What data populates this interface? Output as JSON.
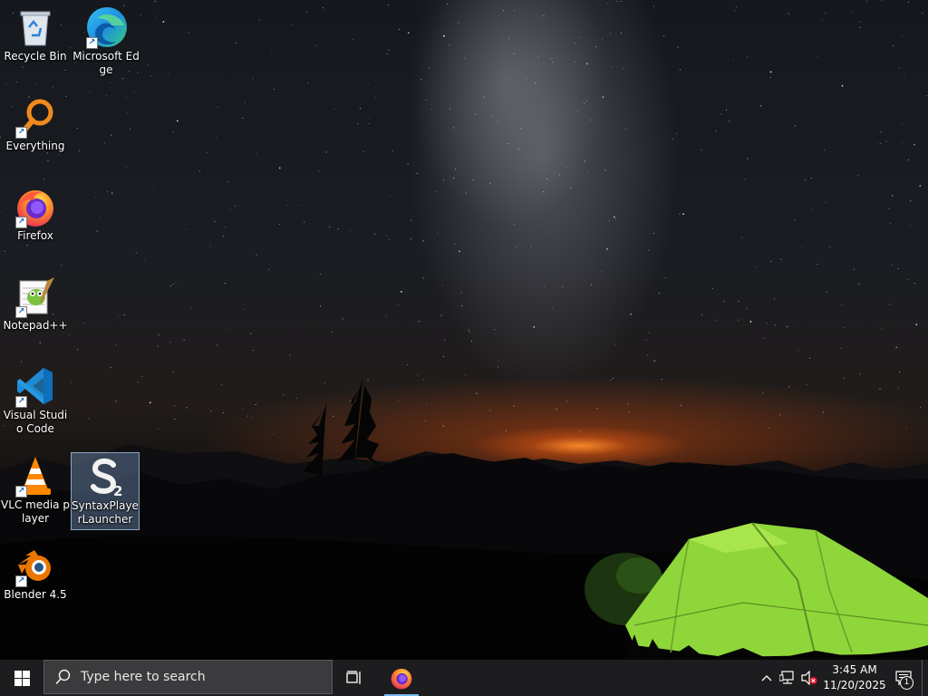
{
  "desktop": {
    "icons": [
      {
        "label": "Recycle Bin",
        "icon": "recycle-bin-icon",
        "shortcut": false
      },
      {
        "label": "Microsoft Edge",
        "icon": "edge-icon",
        "shortcut": true
      },
      {
        "label": "Everything",
        "icon": "everything-search-icon",
        "shortcut": true
      },
      {
        "label": "Firefox",
        "icon": "firefox-icon",
        "shortcut": true
      },
      {
        "label": "Notepad++",
        "icon": "notepad-plus-plus-icon",
        "shortcut": true
      },
      {
        "label": "Visual Studio Code",
        "icon": "vscode-icon",
        "shortcut": true
      },
      {
        "label": "VLC media player",
        "icon": "vlc-icon",
        "shortcut": true
      },
      {
        "label": "SyntaxPlayerLauncher",
        "icon": "syntax-player-icon",
        "shortcut": false,
        "selected": true
      },
      {
        "label": "Blender 4.5",
        "icon": "blender-icon",
        "shortcut": true
      }
    ]
  },
  "taskbar": {
    "search_placeholder": "Type here to search",
    "pinned": [
      {
        "name": "Firefox",
        "icon": "firefox-icon",
        "active": true
      }
    ],
    "clock": {
      "time": "3:45 AM",
      "date": "11/20/2025"
    },
    "notification_count": "1"
  },
  "colors": {
    "taskbar": "#1d1d1f",
    "search_box": "#3b3b3d",
    "active_indicator": "#76b9ed",
    "tent_green": "#8fd63a"
  }
}
